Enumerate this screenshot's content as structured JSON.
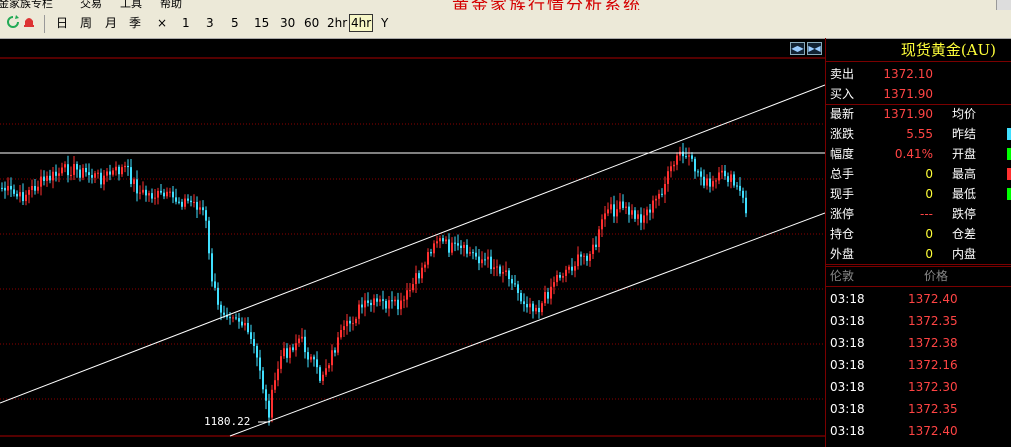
{
  "app": {
    "title": "黄金家族行情分析系统"
  },
  "menu": [
    "金家族专栏",
    "交易",
    "工具",
    "帮助"
  ],
  "toolbar": {
    "periods": [
      "日",
      "周",
      "月",
      "季",
      "×",
      "1",
      "3",
      "5",
      "15",
      "30",
      "60",
      "2hr",
      "4hr",
      "Y"
    ],
    "selected": "4hr"
  },
  "chart": {
    "low_label": "1180.22",
    "colors": {
      "up": "#ff3030",
      "down": "#40e0ff",
      "grid": "#8b0000",
      "line": "#ffffff"
    }
  },
  "quote": {
    "title": "现货黄金(AU)",
    "rows": [
      {
        "label": "卖出",
        "value": "1372.10",
        "label2": "",
        "marker": ""
      },
      {
        "label": "买入",
        "value": "1371.90",
        "label2": "",
        "marker": ""
      },
      {
        "label": "最新",
        "value": "1371.90",
        "label2": "均价",
        "marker": ""
      },
      {
        "label": "涨跌",
        "value": "5.55",
        "label2": "昨结",
        "marker": "#40e0ff"
      },
      {
        "label": "幅度",
        "value": "0.41%",
        "label2": "开盘",
        "marker": "#00ff00"
      },
      {
        "label": "总手",
        "value": "0",
        "label2": "最高",
        "marker": "#ff3030"
      },
      {
        "label": "现手",
        "value": "0",
        "label2": "最低",
        "marker": "#00ff00"
      },
      {
        "label": "涨停",
        "value": "---",
        "label2": "跌停",
        "marker": ""
      },
      {
        "label": "持仓",
        "value": "0",
        "label2": "仓差",
        "marker": ""
      },
      {
        "label": "外盘",
        "value": "0",
        "label2": "内盘",
        "marker": ""
      }
    ]
  },
  "ticks": {
    "headers": [
      "伦敦",
      "价格"
    ],
    "rows": [
      {
        "time": "03:18",
        "price": "1372.40"
      },
      {
        "time": "03:18",
        "price": "1372.35"
      },
      {
        "time": "03:18",
        "price": "1372.38"
      },
      {
        "time": "03:18",
        "price": "1372.16"
      },
      {
        "time": "03:18",
        "price": "1372.30"
      },
      {
        "time": "03:18",
        "price": "1372.35"
      },
      {
        "time": "03:18",
        "price": "1372.40"
      }
    ]
  }
}
